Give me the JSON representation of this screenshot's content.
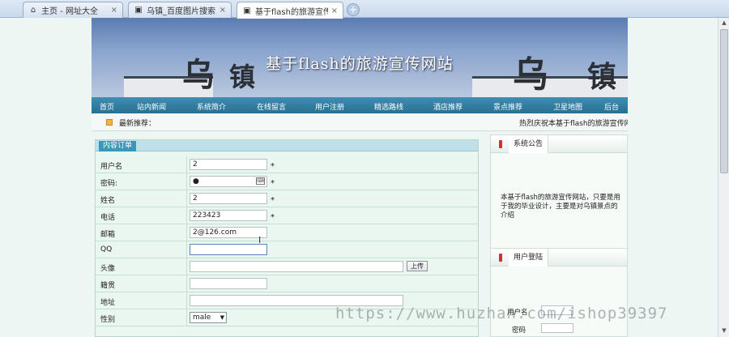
{
  "browser": {
    "tabs": [
      {
        "label": "主页 - 网址大全",
        "icon": "home-icon"
      },
      {
        "label": "乌镇_百度图片搜索",
        "icon": "page-icon"
      },
      {
        "label": "基于flash的旅游宣传网站",
        "icon": "page-icon"
      }
    ],
    "close_glyph": "×",
    "new_tab_glyph": "+"
  },
  "site": {
    "title": "基于flash的旅游宣传网站",
    "banner_glyphs": [
      "乌",
      "镇",
      "乌",
      "镇"
    ],
    "nav": [
      "首页",
      "站内新闻",
      "系统简介",
      "在线留言",
      "用户注册",
      "精选路线",
      "酒店推荐",
      "景点推荐",
      "卫星地图",
      "后台"
    ],
    "recommend_label": "最新推荐：",
    "marquee": "热烈庆祝本基于flash的旅游宣传网站上"
  },
  "form": {
    "tab": "内容订单",
    "rows": [
      {
        "label": "用户名",
        "value": "2",
        "required": "*"
      },
      {
        "label": "密码:",
        "value": "●",
        "required": "*"
      },
      {
        "label": "姓名",
        "value": "2",
        "required": "*"
      },
      {
        "label": "电话",
        "value": "223423",
        "required": "*"
      },
      {
        "label": "邮箱",
        "value": "2@126.com",
        "required": ""
      },
      {
        "label": "QQ",
        "value": "",
        "required": ""
      },
      {
        "label": "头像",
        "value": "",
        "required": ""
      },
      {
        "label": "籍贯",
        "value": "",
        "required": ""
      },
      {
        "label": "地址",
        "value": "",
        "required": ""
      },
      {
        "label": "性别",
        "value": "male",
        "required": ""
      }
    ],
    "upload_button": "上传"
  },
  "sidebar": {
    "notice_title": "系统公告",
    "notice_text": "本基于flash的旅游宣传网站，只要是用于我的毕业设计，主要是对乌镇景点的介绍",
    "login_title": "用户登陆",
    "login_user_label": "用户名",
    "login_pass_label": "密码"
  },
  "watermark": "https://www.huzhan.com/ishop39397"
}
